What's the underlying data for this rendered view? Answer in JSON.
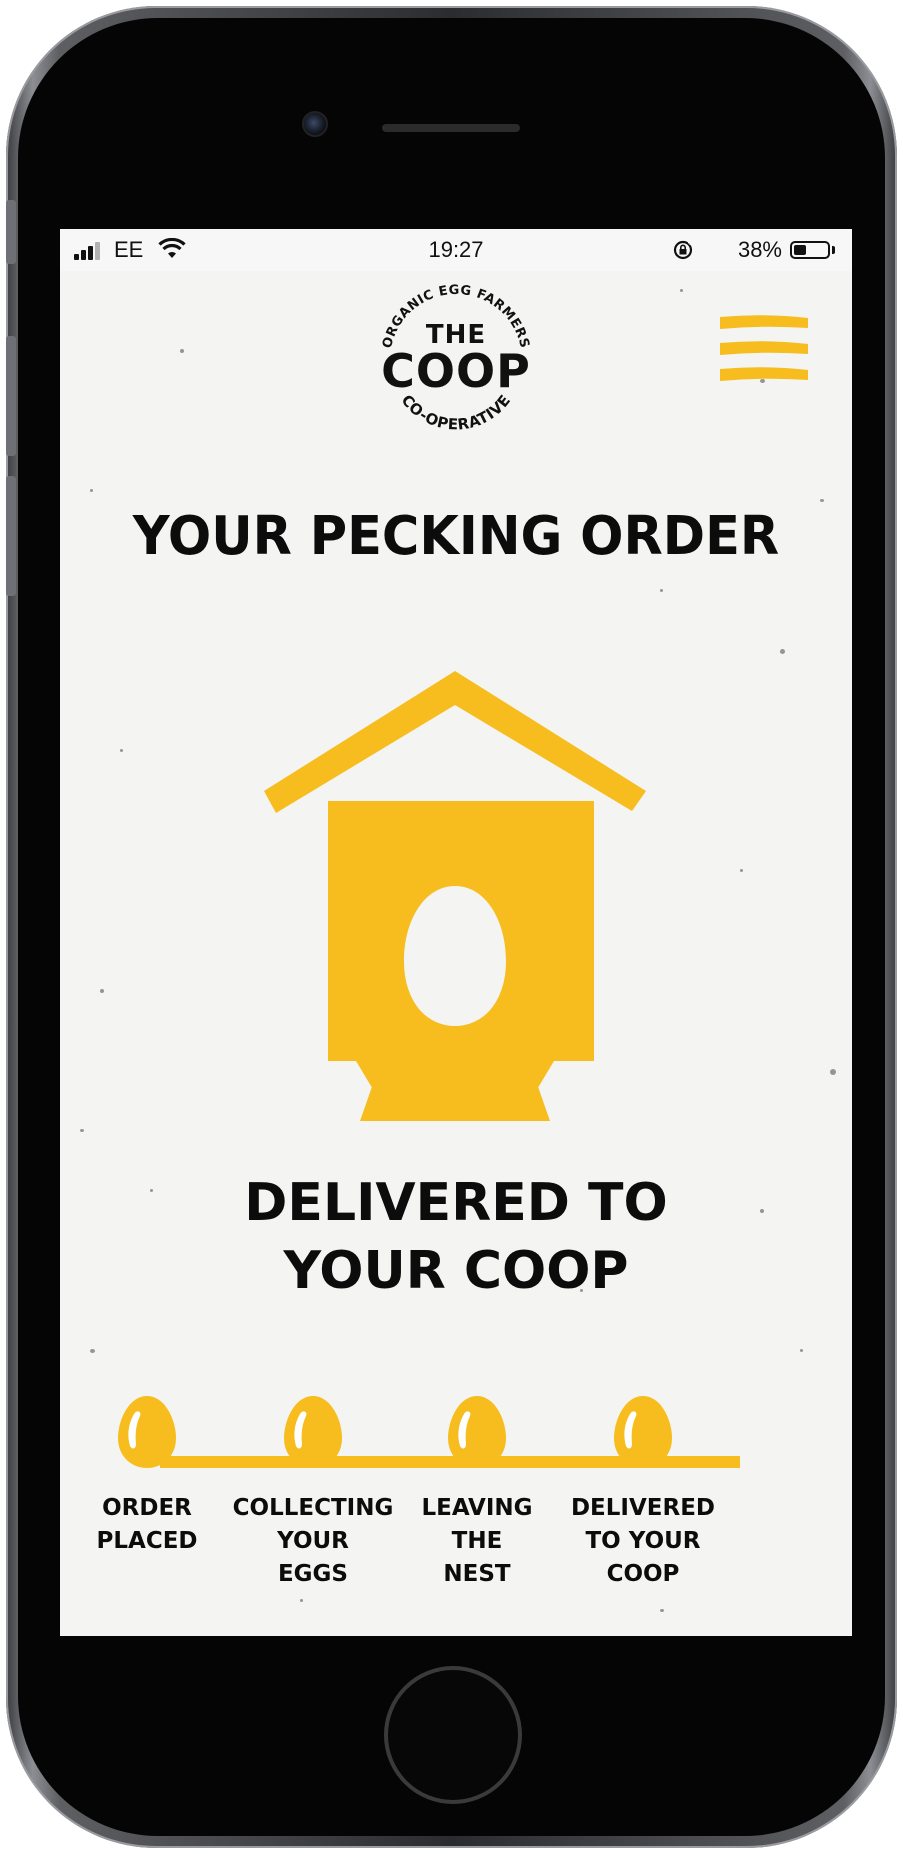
{
  "status_bar": {
    "carrier": "EE",
    "time": "19:27",
    "battery_percent": "38%",
    "battery_level": 0.38
  },
  "header": {
    "logo": {
      "arc_top": "ORGANIC EGG FARMERS",
      "the": "THE",
      "coop": "COOP",
      "arc_bottom": "CO-OPERATIVE"
    },
    "menu_icon": "hamburger-menu-icon"
  },
  "main": {
    "title": "YOUR PECKING ORDER",
    "illustration_icon": "egg-hatch-house-icon",
    "status_line1": "DELIVERED TO",
    "status_line2": "YOUR COOP"
  },
  "tracker": {
    "steps": [
      {
        "label": "ORDER\nPLACED"
      },
      {
        "label": "COLLECTING\nYOUR\nEGGS"
      },
      {
        "label": "LEAVING\nTHE\nNEST"
      },
      {
        "label": "DELIVERED\nTO YOUR\nCOOP"
      }
    ],
    "current_step": 4
  },
  "colors": {
    "accent": "#f7bd1e",
    "text": "#0c0c0c",
    "background": "#f4f4f2"
  }
}
